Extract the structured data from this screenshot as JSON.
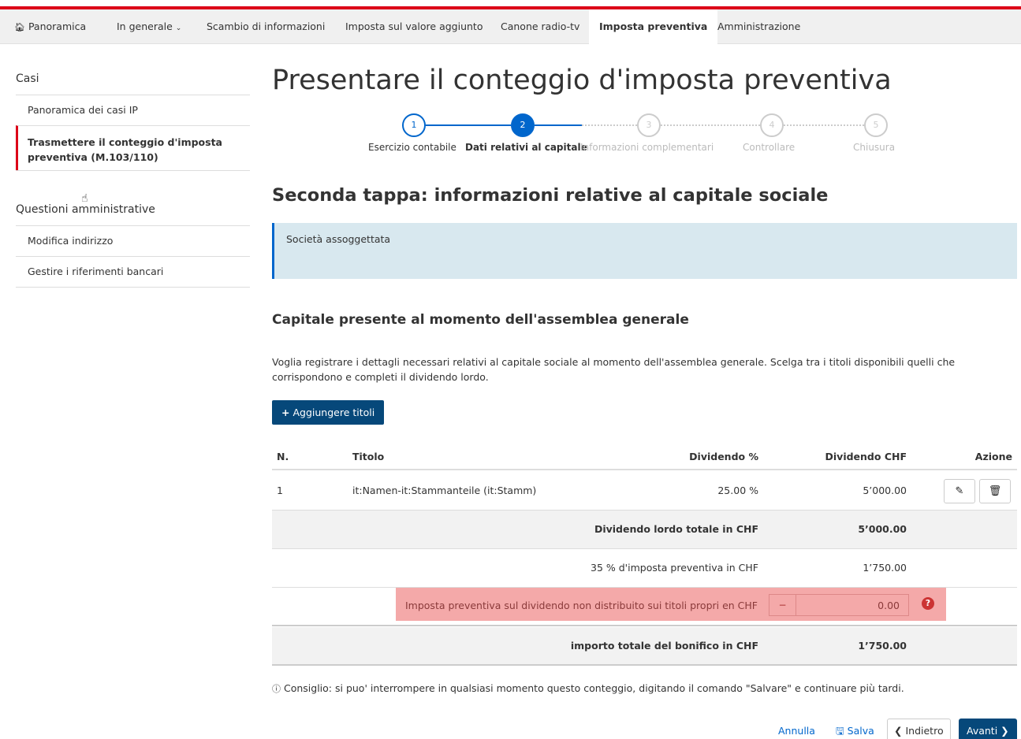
{
  "nav": {
    "items": [
      {
        "label": "Panoramica",
        "icon": "home-icon"
      },
      {
        "label": "In generale"
      },
      {
        "label": "Scambio di informazioni"
      },
      {
        "label": "Imposta sul valore aggiunto"
      },
      {
        "label": "Canone radio-tv"
      },
      {
        "label": "Imposta preventiva"
      },
      {
        "label": "Amministrazione"
      }
    ],
    "active_item": "Imposta preventiva",
    "accent_color": "#dc0018"
  },
  "sidebar": {
    "cases_heading": "Casi",
    "cases_items": [
      {
        "label": "Panoramica dei casi IP"
      },
      {
        "label": "Trasmettere il conteggio d'imposta preventiva (M.103/110)"
      }
    ],
    "active_item": "Trasmettere il conteggio d'imposta preventiva (M.103/110)",
    "admin_heading": "Questioni amministrative",
    "admin_items": [
      {
        "label": "Modifica indirizzo"
      },
      {
        "label": "Gestire i riferimenti bancari"
      }
    ]
  },
  "main": {
    "page_title": "Presentare il conteggio d'imposta preventiva",
    "steps": [
      {
        "number": "1",
        "label": "Esercizio contabile",
        "state": "done"
      },
      {
        "number": "2",
        "label": "Dati relativi al capitale",
        "state": "current"
      },
      {
        "number": "3",
        "label": "Informazioni complementari",
        "state": "todo"
      },
      {
        "number": "4",
        "label": "Controllare",
        "state": "todo"
      },
      {
        "number": "5",
        "label": "Chiusura",
        "state": "todo"
      }
    ],
    "section_title": "Seconda tappa: informazioni relative al capitale sociale",
    "info_text": "Società assoggettata",
    "sub_title": "Capitale presente al momento dell'assemblea generale",
    "description": "Voglia registrare i dettagli necessari relativi al capitale sociale al momento dell'assemblea generale. Scelga tra i titoli disponibili quelli che corrispondono e completi il dividendo lordo.",
    "add_button": "Aggiungere titoli",
    "table": {
      "headers": {
        "n": "N.",
        "titolo": "Titolo",
        "div_pct": "Dividendo %",
        "div_chf": "Dividendo CHF",
        "azione": "Azione"
      },
      "rows": [
        {
          "n": "1",
          "titolo": "it:Namen-it:Stammanteile (it:Stamm)",
          "div_pct": "25.00 %",
          "div_chf": "5’000.00"
        }
      ],
      "total_label": "Dividendo lordo totale in CHF",
      "total_value": "5’000.00",
      "tax_label": "35 % d'imposta preventiva in CHF",
      "tax_value": "1’750.00",
      "own_titles_label": "Imposta preventiva sul dividendo non distribuito sui titoli propri en CHF",
      "own_titles_minus": "−",
      "own_titles_value": "0.00",
      "transfer_label": "importo totale del bonifico in CHF",
      "transfer_value": "1’750.00"
    },
    "tip": "Consiglio: si puo' interrompere in qualsiasi momento questo conteggio, digitando il comando \"Salvare\" e continuare più tardi.",
    "buttons": {
      "cancel": "Annulla",
      "save": "Salva",
      "back": "Indietro",
      "next": "Avanti"
    }
  }
}
